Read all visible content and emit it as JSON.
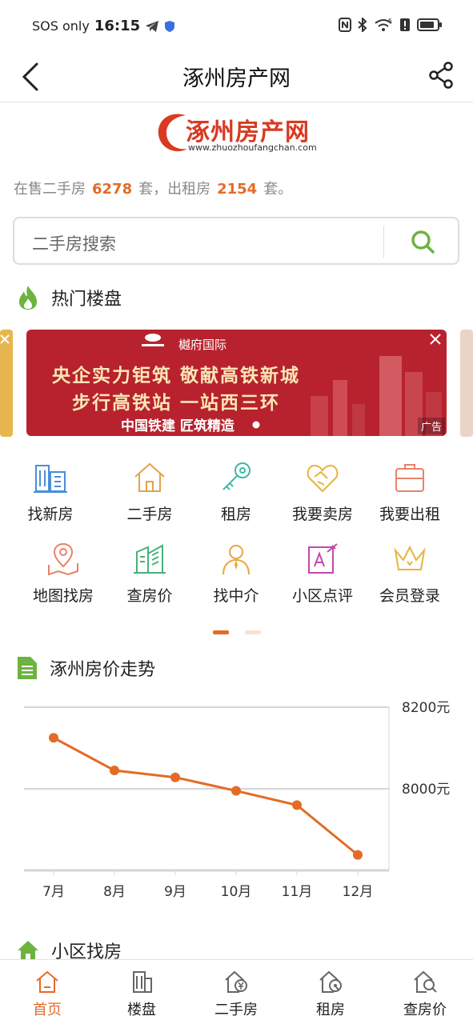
{
  "status": {
    "carrier": "SOS only",
    "time": "16:15",
    "network": "6"
  },
  "nav": {
    "title": "涿州房产网"
  },
  "logo": {
    "text": "涿州房产网",
    "url": "www.zhuozhoufangchan.com"
  },
  "stats": {
    "prefix": "在售二手房",
    "sale_count": "6278",
    "mid": "套，出租房",
    "rent_count": "2154",
    "suffix": "套。"
  },
  "search": {
    "placeholder": "二手房搜索"
  },
  "hot": {
    "title": "热门楼盘"
  },
  "banner": {
    "brand": "樾府国际",
    "line1": "央企实力钜筑 敬献高铁新城",
    "line2": "步行高铁站 一站西三环",
    "line3": "中国铁建 匠筑精造",
    "ad": "广告"
  },
  "menu": [
    {
      "label": "找新房",
      "icon": "building-icon",
      "color": "#4a8fd6"
    },
    {
      "label": "二手房",
      "icon": "house-icon",
      "color": "#e3a24a"
    },
    {
      "label": "租房",
      "icon": "key-icon",
      "color": "#3fb7a7"
    },
    {
      "label": "我要卖房",
      "icon": "handshake-icon",
      "color": "#e7b43c"
    },
    {
      "label": "我要出租",
      "icon": "suitcase-icon",
      "color": "#e8826a"
    },
    {
      "label": "地图找房",
      "icon": "map-pin-icon",
      "color": "#e8826a"
    },
    {
      "label": "查房价",
      "icon": "buildings-icon",
      "color": "#47b27a"
    },
    {
      "label": "找中介",
      "icon": "agent-icon",
      "color": "#e7a83c"
    },
    {
      "label": "小区点评",
      "icon": "review-icon",
      "color": "#c447b0"
    },
    {
      "label": "会员登录",
      "icon": "crown-icon",
      "color": "#e7b43c"
    }
  ],
  "trend": {
    "title": "涿州房价走势"
  },
  "chart_data": {
    "type": "line",
    "categories": [
      "7月",
      "8月",
      "9月",
      "10月",
      "11月",
      "12月"
    ],
    "values": [
      8125,
      8045,
      8028,
      7995,
      7960,
      7838
    ],
    "ylim": [
      7800,
      8200
    ],
    "y_ticks": [
      "8200元",
      "8000元"
    ],
    "color": "#e46b26",
    "grid": true
  },
  "community": {
    "title": "小区找房"
  },
  "tabs": [
    {
      "label": "首页",
      "icon": "home-icon",
      "active": true
    },
    {
      "label": "楼盘",
      "icon": "tower-icon",
      "active": false
    },
    {
      "label": "二手房",
      "icon": "yen-house-icon",
      "active": false
    },
    {
      "label": "租房",
      "icon": "rent-house-icon",
      "active": false
    },
    {
      "label": "查房价",
      "icon": "search-house-icon",
      "active": false
    }
  ],
  "colors": {
    "accent": "#e46b26",
    "brand": "#d83a22",
    "banner_bg": "#b7222e",
    "section_icon": "#6cb33f"
  }
}
